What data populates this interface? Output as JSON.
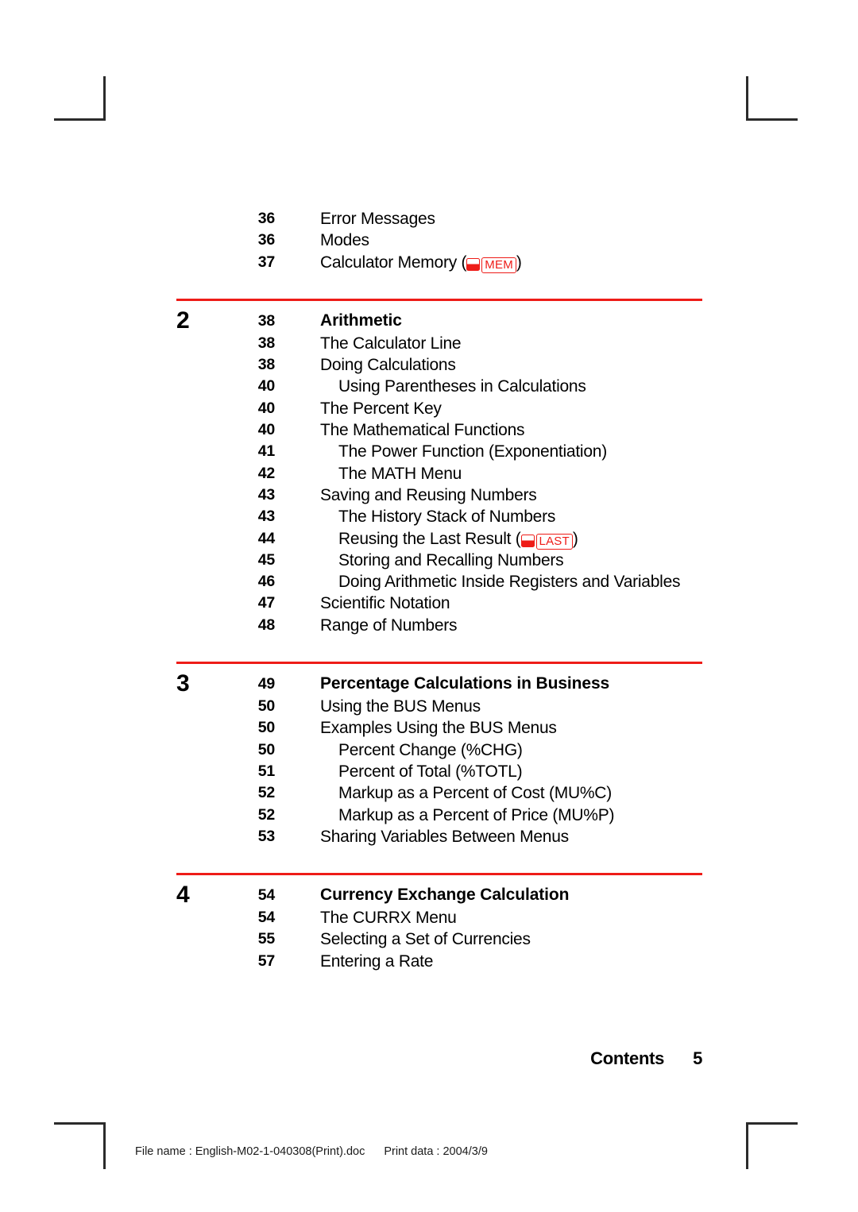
{
  "document": {
    "running_foot_label": "Contents",
    "running_foot_page": "5",
    "file_info_name": "File name : English-M02-1-040308(Print).doc",
    "file_info_print": "Print data : 2004/3/9"
  },
  "colors": {
    "rule_red": "#ee1c18",
    "key_red": "#ee1c18",
    "text_black": "#000000"
  },
  "toc": {
    "continued_rows": [
      {
        "page": "36",
        "title": "Error Messages",
        "level": 1
      },
      {
        "page": "36",
        "title": "Modes",
        "level": 1
      },
      {
        "page": "37",
        "title": "Calculator Memory (",
        "level": 1,
        "key_shift": "shift-key-icon",
        "key_label": "MEM",
        "title_suffix": ")"
      }
    ],
    "groups": [
      {
        "chapter": "2",
        "page": "38",
        "chapter_title": "Arithmetic",
        "rows": [
          {
            "page": "38",
            "title": "The Calculator Line",
            "level": 1
          },
          {
            "page": "38",
            "title": "Doing Calculations",
            "level": 1
          },
          {
            "page": "40",
            "title": "Using Parentheses in Calculations",
            "level": 2
          },
          {
            "page": "40",
            "title": "The Percent Key",
            "level": 1
          },
          {
            "page": "40",
            "title": "The Mathematical Functions",
            "level": 1
          },
          {
            "page": "41",
            "title": "The Power Function (Exponentiation)",
            "level": 2
          },
          {
            "page": "42",
            "title": "The MATH Menu",
            "level": 2
          },
          {
            "page": "43",
            "title": "Saving and Reusing Numbers",
            "level": 1
          },
          {
            "page": "43",
            "title": "The History Stack of Numbers",
            "level": 2
          },
          {
            "page": "44",
            "title": "Reusing the Last Result (",
            "level": 2,
            "key_shift": "shift-key-icon",
            "key_label": "LAST",
            "title_suffix": ")"
          },
          {
            "page": "45",
            "title": "Storing and Recalling Numbers",
            "level": 2
          },
          {
            "page": "46",
            "title": "Doing Arithmetic Inside Registers and Variables",
            "level": 2
          },
          {
            "page": "47",
            "title": "Scientific Notation",
            "level": 1
          },
          {
            "page": "48",
            "title": "Range of Numbers",
            "level": 1
          }
        ]
      },
      {
        "chapter": "3",
        "page": "49",
        "chapter_title": "Percentage Calculations in Business",
        "rows": [
          {
            "page": "50",
            "title": "Using the BUS Menus",
            "level": 1
          },
          {
            "page": "50",
            "title": "Examples Using the BUS Menus",
            "level": 1
          },
          {
            "page": "50",
            "title": "Percent Change (%CHG)",
            "level": 2
          },
          {
            "page": "51",
            "title": "Percent of Total (%TOTL)",
            "level": 2
          },
          {
            "page": "52",
            "title": "Markup as a Percent of Cost (MU%C)",
            "level": 2
          },
          {
            "page": "52",
            "title": "Markup as a Percent of Price (MU%P)",
            "level": 2
          },
          {
            "page": "53",
            "title": "Sharing Variables Between Menus",
            "level": 1
          }
        ]
      },
      {
        "chapter": "4",
        "page": "54",
        "chapter_title": "Currency Exchange Calculation",
        "rows": [
          {
            "page": "54",
            "title": "The CURRX Menu",
            "level": 1
          },
          {
            "page": "55",
            "title": "Selecting a Set of Currencies",
            "level": 1
          },
          {
            "page": "57",
            "title": "Entering a Rate",
            "level": 1
          }
        ]
      }
    ]
  }
}
